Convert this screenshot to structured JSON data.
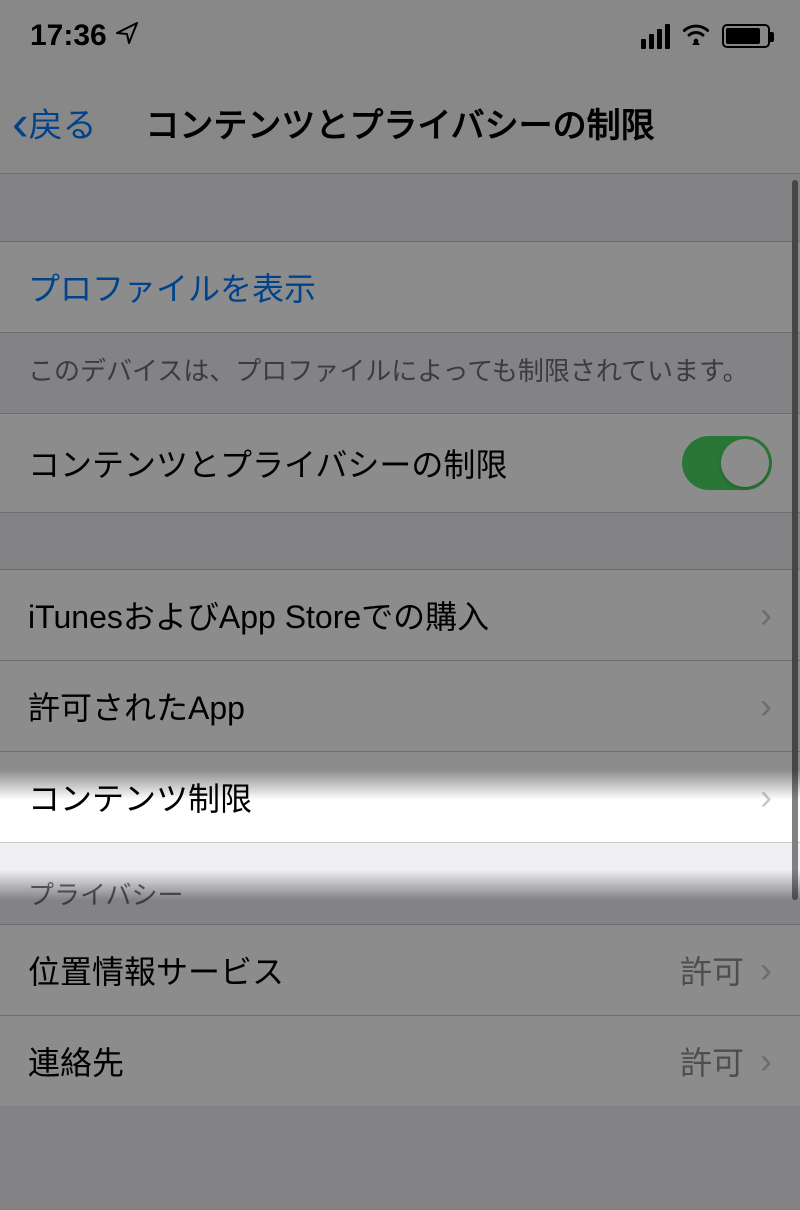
{
  "status_bar": {
    "time": "17:36",
    "location_active": true
  },
  "nav": {
    "back_label": "戻る",
    "title": "コンテンツとプライバシーの制限"
  },
  "profile": {
    "show_label": "プロファイルを表示",
    "note": "このデバイスは、プロファイルによっても制限されています。"
  },
  "toggle_row": {
    "label": "コンテンツとプライバシーの制限",
    "enabled": true
  },
  "group_restrictions": {
    "items": [
      {
        "label": "iTunesおよびApp Storeでの購入"
      },
      {
        "label": "許可されたApp"
      },
      {
        "label": "コンテンツ制限"
      }
    ]
  },
  "privacy_section": {
    "header": "プライバシー",
    "items": [
      {
        "label": "位置情報サービス",
        "value": "許可"
      },
      {
        "label": "連絡先",
        "value": "許可"
      }
    ]
  }
}
